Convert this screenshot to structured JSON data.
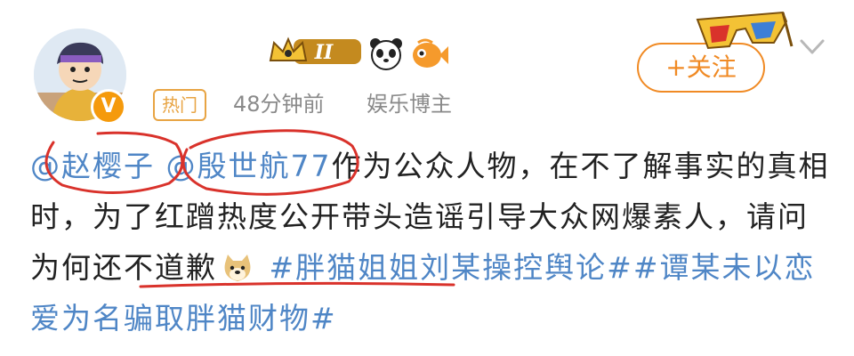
{
  "post": {
    "meta": {
      "hot_tag": "热门",
      "time": "48分钟前",
      "role": "娱乐博主"
    },
    "level_badge": "II",
    "verified_badge": "V",
    "follow_label": "+关注",
    "content": {
      "mention_1": "@赵樱子",
      "mention_2": "@殷世航77",
      "text_1": "作为公众人物，在不了解事实的真相时，为了红蹭热度公开带头造谣引导大众网爆素人，请问为何还不道歉",
      "hashtag_1": "#胖猫姐姐刘某操控舆论#",
      "hashtag_2": "#谭某未以恋爱为名骗取胖猫财物#"
    },
    "icons": {
      "avatar": "cartoon-avatar",
      "verified": "verified-v-icon",
      "level": "level-crown-icon",
      "panda": "panda-icon",
      "fish": "fish-icon",
      "glasses": "3d-glasses-icon",
      "chevron": "chevron-down-icon",
      "emoji": "doge-icon"
    },
    "colors": {
      "link": "#4f86c6",
      "accent": "#f08a24",
      "annotation_red": "#d9322b",
      "meta_gray": "#8a8a8a"
    }
  }
}
